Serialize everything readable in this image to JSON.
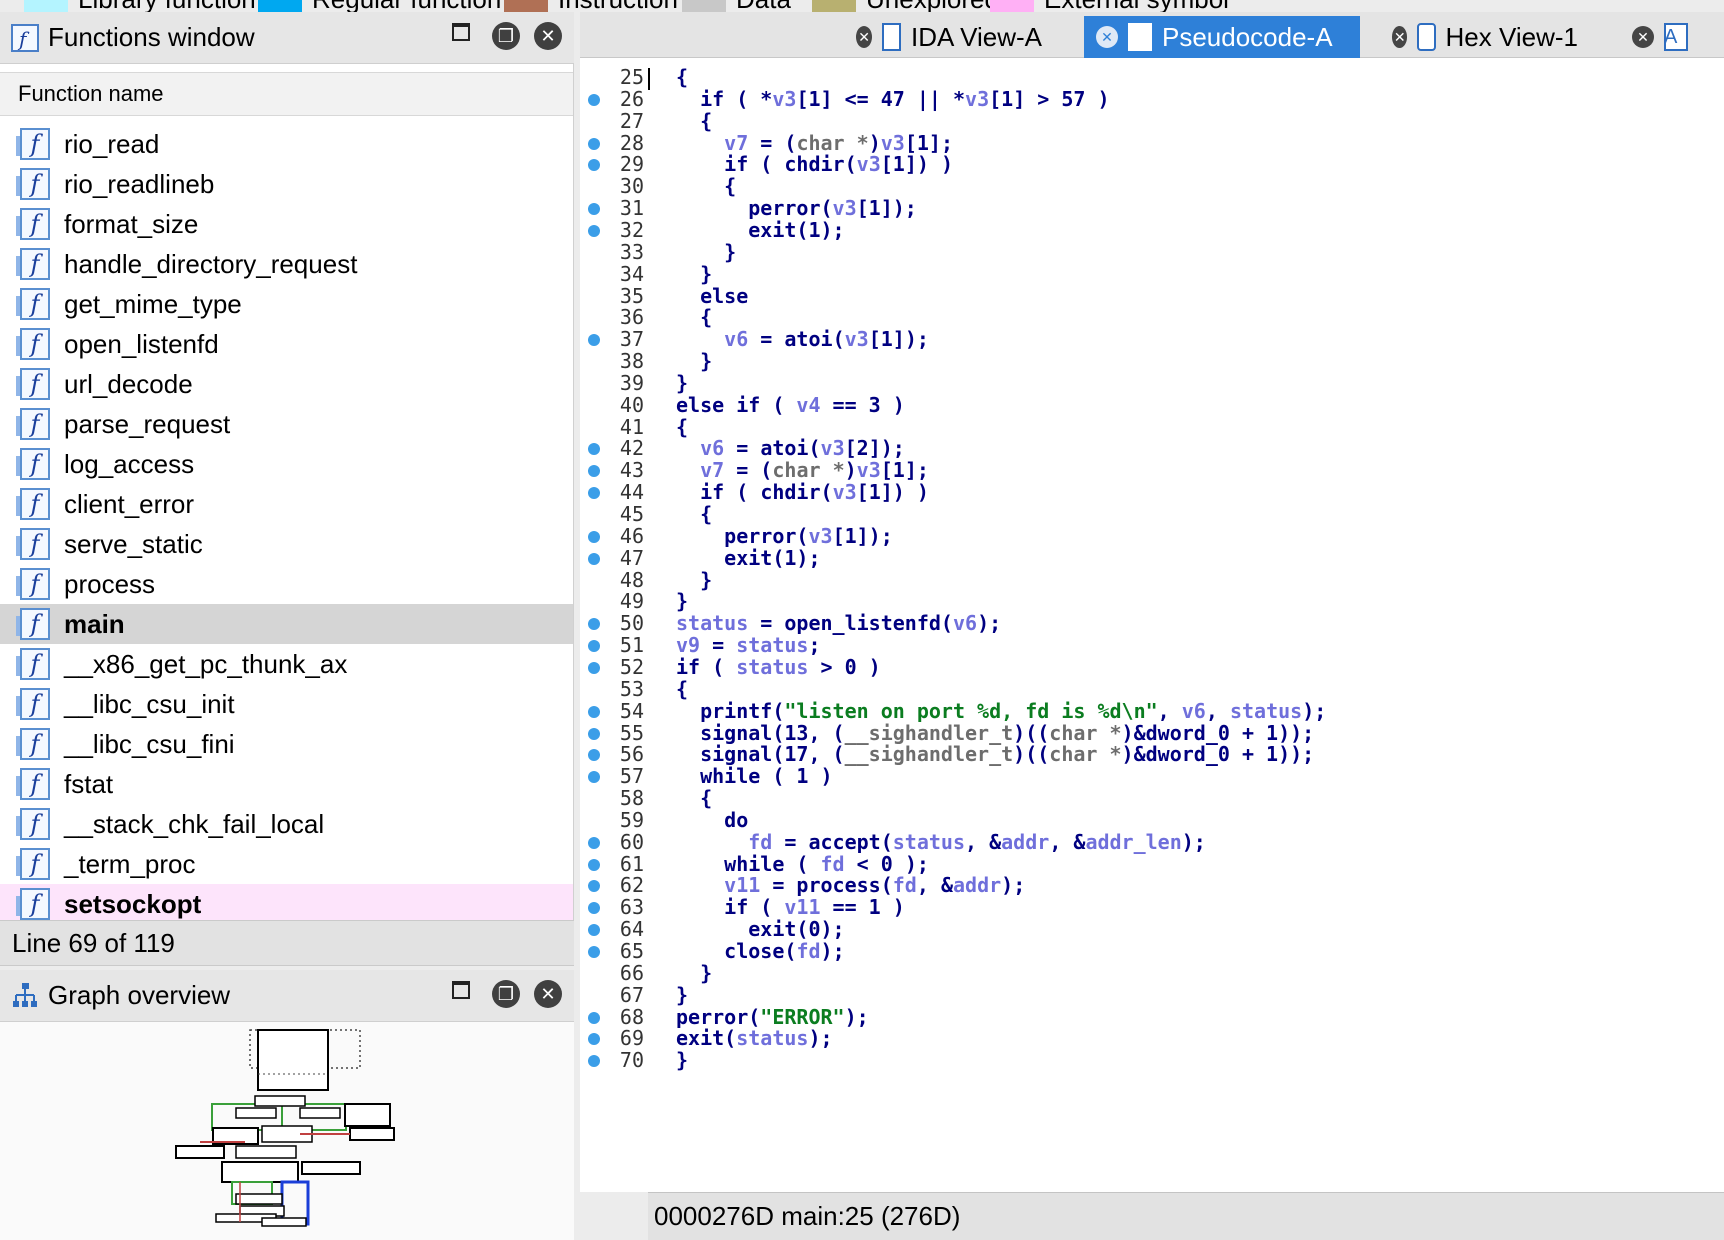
{
  "legend": [
    {
      "label": "Library function",
      "color": "#b4f4ff"
    },
    {
      "label": "Regular function",
      "color": "#00a8f0"
    },
    {
      "label": "Instruction",
      "color": "#b07055"
    },
    {
      "label": "Data",
      "color": "#c8c8c8"
    },
    {
      "label": "Unexplored",
      "color": "#b8b070"
    },
    {
      "label": "External symbol",
      "color": "#ffb0f5"
    }
  ],
  "functions_window": {
    "title": "Functions window",
    "column_header": "Function name",
    "functions": [
      {
        "name": "rio_read"
      },
      {
        "name": "rio_readlineb"
      },
      {
        "name": "format_size"
      },
      {
        "name": "handle_directory_request"
      },
      {
        "name": "get_mime_type"
      },
      {
        "name": "open_listenfd"
      },
      {
        "name": "url_decode"
      },
      {
        "name": "parse_request"
      },
      {
        "name": "log_access"
      },
      {
        "name": "client_error"
      },
      {
        "name": "serve_static"
      },
      {
        "name": "process"
      },
      {
        "name": "main"
      },
      {
        "name": "__x86_get_pc_thunk_ax"
      },
      {
        "name": "__libc_csu_init"
      },
      {
        "name": "__libc_csu_fini"
      },
      {
        "name": "fstat"
      },
      {
        "name": "__stack_chk_fail_local"
      },
      {
        "name": "_term_proc"
      },
      {
        "name": "setsockopt"
      }
    ],
    "status": "Line 69 of 119"
  },
  "graph_overview": {
    "title": "Graph overview"
  },
  "tabs": [
    {
      "label": "IDA View-A"
    },
    {
      "label": "Pseudocode-A"
    },
    {
      "label": "Hex View-1"
    },
    {
      "label": "A"
    }
  ],
  "code": {
    "lines": [
      {
        "n": "25",
        "dot": false
      },
      {
        "n": "26",
        "dot": true
      },
      {
        "n": "27",
        "dot": false
      },
      {
        "n": "28",
        "dot": true
      },
      {
        "n": "29",
        "dot": true
      },
      {
        "n": "30",
        "dot": false
      },
      {
        "n": "31",
        "dot": true
      },
      {
        "n": "32",
        "dot": true
      },
      {
        "n": "33",
        "dot": false
      },
      {
        "n": "34",
        "dot": false
      },
      {
        "n": "35",
        "dot": false
      },
      {
        "n": "36",
        "dot": false
      },
      {
        "n": "37",
        "dot": true
      },
      {
        "n": "38",
        "dot": false
      },
      {
        "n": "39",
        "dot": false
      },
      {
        "n": "40",
        "dot": false
      },
      {
        "n": "41",
        "dot": false
      },
      {
        "n": "42",
        "dot": true
      },
      {
        "n": "43",
        "dot": true
      },
      {
        "n": "44",
        "dot": true
      },
      {
        "n": "45",
        "dot": false
      },
      {
        "n": "46",
        "dot": true
      },
      {
        "n": "47",
        "dot": true
      },
      {
        "n": "48",
        "dot": false
      },
      {
        "n": "49",
        "dot": false
      },
      {
        "n": "50",
        "dot": true
      },
      {
        "n": "51",
        "dot": true
      },
      {
        "n": "52",
        "dot": true
      },
      {
        "n": "53",
        "dot": false
      },
      {
        "n": "54",
        "dot": true
      },
      {
        "n": "55",
        "dot": true
      },
      {
        "n": "56",
        "dot": true
      },
      {
        "n": "57",
        "dot": true
      },
      {
        "n": "58",
        "dot": false
      },
      {
        "n": "59",
        "dot": false
      },
      {
        "n": "60",
        "dot": true
      },
      {
        "n": "61",
        "dot": true
      },
      {
        "n": "62",
        "dot": true
      },
      {
        "n": "63",
        "dot": true
      },
      {
        "n": "64",
        "dot": true
      },
      {
        "n": "65",
        "dot": true
      },
      {
        "n": "66",
        "dot": false
      },
      {
        "n": "67",
        "dot": false
      },
      {
        "n": "68",
        "dot": true
      },
      {
        "n": "69",
        "dot": true
      },
      {
        "n": "70",
        "dot": true
      }
    ],
    "status": "0000276D  main:25 (276D)"
  },
  "code_text": {
    "l25": "{",
    "l26": [
      "  ",
      [
        "kw",
        "if"
      ],
      " ( *",
      [
        "var",
        "v3"
      ],
      "[1] <= 47 || *",
      [
        "var",
        "v3"
      ],
      "[1] > 57 )"
    ],
    "l27": "  {",
    "l28": [
      "    ",
      [
        "var",
        "v7"
      ],
      " = (",
      [
        "typ",
        "char *"
      ],
      ")",
      [
        "var",
        "v3"
      ],
      "[1];"
    ],
    "l29": [
      "    ",
      [
        "kw",
        "if"
      ],
      " ( ",
      [
        "kw",
        "chdir"
      ],
      "(",
      [
        "var",
        "v3"
      ],
      "[1]) )"
    ],
    "l30": "    {",
    "l31": [
      "      ",
      [
        "kw",
        "perror"
      ],
      "(",
      [
        "var",
        "v3"
      ],
      "[1]);"
    ],
    "l32": [
      "      ",
      [
        "kw",
        "exit"
      ],
      "(1);"
    ],
    "l33": "    }",
    "l34": "  }",
    "l35": [
      "  ",
      [
        "kw",
        "else"
      ]
    ],
    "l36": "  {",
    "l37": [
      "    ",
      [
        "var",
        "v6"
      ],
      " = ",
      [
        "kw",
        "atoi"
      ],
      "(",
      [
        "var",
        "v3"
      ],
      "[1]);"
    ],
    "l38": "  }",
    "l39": "}",
    "l40": [
      [
        "kw",
        "else if"
      ],
      " ( ",
      [
        "var",
        "v4"
      ],
      " == 3 )"
    ],
    "l41": "{",
    "l42": [
      "  ",
      [
        "var",
        "v6"
      ],
      " = ",
      [
        "kw",
        "atoi"
      ],
      "(",
      [
        "var",
        "v3"
      ],
      "[2]);"
    ],
    "l43": [
      "  ",
      [
        "var",
        "v7"
      ],
      " = (",
      [
        "typ",
        "char *"
      ],
      ")",
      [
        "var",
        "v3"
      ],
      "[1];"
    ],
    "l44": [
      "  ",
      [
        "kw",
        "if"
      ],
      " ( ",
      [
        "kw",
        "chdir"
      ],
      "(",
      [
        "var",
        "v3"
      ],
      "[1]) )"
    ],
    "l45": "  {",
    "l46": [
      "    ",
      [
        "kw",
        "perror"
      ],
      "(",
      [
        "var",
        "v3"
      ],
      "[1]);"
    ],
    "l47": [
      "    ",
      [
        "kw",
        "exit"
      ],
      "(1);"
    ],
    "l48": "  }",
    "l49": "}",
    "l50": [
      [
        "var",
        "status"
      ],
      " = ",
      [
        "kw",
        "open_listenfd"
      ],
      "(",
      [
        "var",
        "v6"
      ],
      ");"
    ],
    "l51": [
      [
        "var",
        "v9"
      ],
      " = ",
      [
        "var",
        "status"
      ],
      ";"
    ],
    "l52": [
      [
        "kw",
        "if"
      ],
      " ( ",
      [
        "var",
        "status"
      ],
      " > 0 )"
    ],
    "l53": "{",
    "l54": [
      "  ",
      [
        "kw",
        "printf"
      ],
      "(",
      [
        "str",
        "\"listen on port %d, fd is %d\\n\""
      ],
      ", ",
      [
        "var",
        "v6"
      ],
      ", ",
      [
        "var",
        "status"
      ],
      ");"
    ],
    "l55": [
      "  ",
      [
        "kw",
        "signal"
      ],
      "(13, (",
      [
        "typ",
        "__sighandler_t"
      ],
      ")((",
      [
        "typ",
        "char *"
      ],
      ")&",
      [
        "kw",
        "dword_0"
      ],
      " + 1));"
    ],
    "l56": [
      "  ",
      [
        "kw",
        "signal"
      ],
      "(17, (",
      [
        "typ",
        "__sighandler_t"
      ],
      ")((",
      [
        "typ",
        "char *"
      ],
      ")&",
      [
        "kw",
        "dword_0"
      ],
      " + 1));"
    ],
    "l57": [
      "  ",
      [
        "kw",
        "while"
      ],
      " ( 1 )"
    ],
    "l58": "  {",
    "l59": [
      "    ",
      [
        "kw",
        "do"
      ]
    ],
    "l60": [
      "      ",
      [
        "var",
        "fd"
      ],
      " = ",
      [
        "kw",
        "accept"
      ],
      "(",
      [
        "var",
        "status"
      ],
      ", &",
      [
        "var",
        "addr"
      ],
      ", &",
      [
        "var",
        "addr_len"
      ],
      ");"
    ],
    "l61": [
      "    ",
      [
        "kw",
        "while"
      ],
      " ( ",
      [
        "var",
        "fd"
      ],
      " < 0 );"
    ],
    "l62": [
      "    ",
      [
        "var",
        "v11"
      ],
      " = ",
      [
        "kw",
        "process"
      ],
      "(",
      [
        "var",
        "fd"
      ],
      ", &",
      [
        "var",
        "addr"
      ],
      ");"
    ],
    "l63": [
      "    ",
      [
        "kw",
        "if"
      ],
      " ( ",
      [
        "var",
        "v11"
      ],
      " == 1 )"
    ],
    "l64": [
      "      ",
      [
        "kw",
        "exit"
      ],
      "(0);"
    ],
    "l65": [
      "    ",
      [
        "kw",
        "close"
      ],
      "(",
      [
        "var",
        "fd"
      ],
      ");"
    ],
    "l66": "  }",
    "l67": "}",
    "l68": [
      [
        "kw",
        "perror"
      ],
      "(",
      [
        "str",
        "\"ERROR\""
      ],
      ");"
    ],
    "l69": [
      [
        "kw",
        "exit"
      ],
      "(",
      [
        "var",
        "status"
      ],
      ");"
    ],
    "l70": "}"
  }
}
